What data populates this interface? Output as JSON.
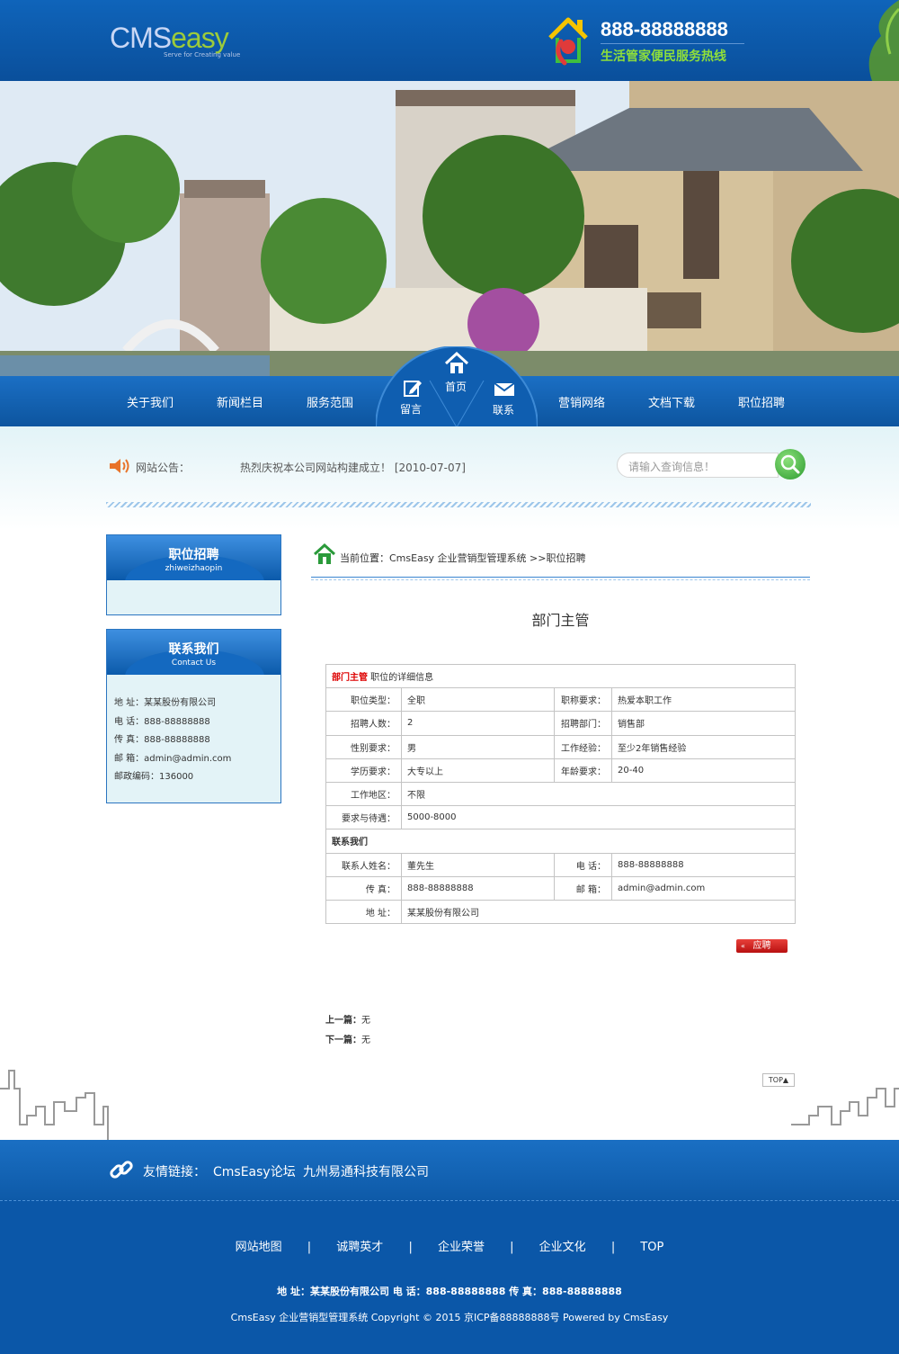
{
  "header": {
    "logo_text_a": "CMS",
    "logo_text_b": "easy",
    "logo_tagline": "Serve for Creating value",
    "phone": "888-88888888",
    "hotline_label": "生活管家便民服务热线"
  },
  "nav": {
    "items": [
      "关于我们",
      "新闻栏目",
      "服务范围",
      "营销网络",
      "文档下载",
      "职位招聘"
    ],
    "center": [
      "首页",
      "留言",
      "联系"
    ]
  },
  "notice": {
    "label": "网站公告：",
    "text": "热烈庆祝本公司网站构建成立！ [2010-07-07]"
  },
  "search": {
    "placeholder": "请输入查询信息！"
  },
  "sidebar": {
    "jobs_title": "职位招聘",
    "jobs_sub": "zhiweizhaopin",
    "contact_title": "联系我们",
    "contact_sub": "Contact Us",
    "contact_lines": [
      "地 址：某某股份有限公司",
      "电 话：888-88888888",
      "传 真：888-88888888",
      "邮 箱：admin@admin.com",
      "邮政编码：136000"
    ]
  },
  "breadcrumb": {
    "text": "当前位置：CmsEasy 企业营销型管理系统 >>职位招聘"
  },
  "job": {
    "title": "部门主管",
    "header_red": "部门主管",
    "header_rest": " 职位的详细信息",
    "rows": [
      {
        "l1": "职位类型：",
        "v1": "全职",
        "l2": "职称要求：",
        "v2": "热爱本职工作"
      },
      {
        "l1": "招聘人数：",
        "v1": "2",
        "l2": "招聘部门：",
        "v2": "销售部"
      },
      {
        "l1": "性别要求：",
        "v1": "男",
        "l2": "工作经验：",
        "v2": "至少2年销售经验"
      },
      {
        "l1": "学历要求：",
        "v1": "大专以上",
        "l2": "年龄要求：",
        "v2": "20-40"
      }
    ],
    "area_label": "工作地区：",
    "area_value": "不限",
    "salary_label": "要求与待遇：",
    "salary_value": "5000-8000",
    "contact_header": "联系我们",
    "contact_name_label": "联系人姓名：",
    "contact_name": "董先生",
    "tel_label": "电 话：",
    "tel": "888-88888888",
    "fax_label": "传 真：",
    "fax": "888-88888888",
    "email_label": "邮 箱：",
    "email": "admin@admin.com",
    "addr_label": "地 址：",
    "addr": "某某股份有限公司",
    "apply_label": "应聘",
    "apply_arrow": "«"
  },
  "prevnext": {
    "prev_label": "上一篇：",
    "prev_value": "无",
    "next_label": "下一篇：",
    "next_value": "无"
  },
  "top_label": "TOP▲",
  "links": {
    "label": "友情链接：",
    "items": [
      "CmsEasy论坛",
      "九州易通科技有限公司"
    ]
  },
  "footer": {
    "nav": [
      "网站地图",
      "|",
      "诚聘英才",
      "|",
      "企业荣誉",
      "|",
      "企业文化",
      "|",
      "TOP"
    ],
    "addr": "地 址：某某股份有限公司   电 话：888-88888888   传 真：888-88888888",
    "copy": "CmsEasy 企业营销型管理系统 Copyright © 2015 京ICP备88888888号 Powered by CmsEasy"
  },
  "colors": {
    "primary": "#0b57a8",
    "accent_green": "#8fdf3a",
    "accent_red": "#d00000"
  }
}
